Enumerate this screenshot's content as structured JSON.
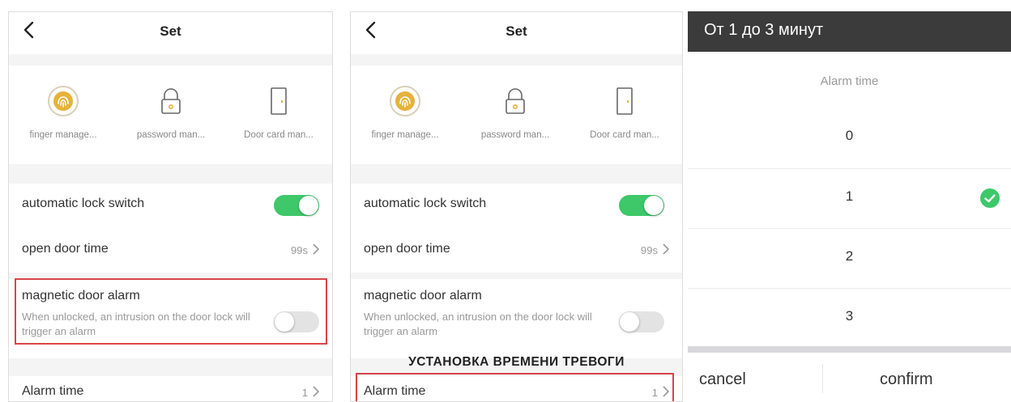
{
  "colors": {
    "accent_green": "#3ec86a",
    "highlight_red": "#d9434a",
    "header_dark": "#3b3b3b"
  },
  "left_screen": {
    "title": "Set",
    "quick_actions": [
      {
        "label": "finger manage...",
        "icon": "fingerprint-icon"
      },
      {
        "label": "password man...",
        "icon": "lock-icon"
      },
      {
        "label": "Door card man...",
        "icon": "door-icon"
      }
    ],
    "auto_lock": {
      "label": "automatic lock switch",
      "state": "on"
    },
    "open_door_time": {
      "label": "open door time",
      "value": "99s"
    },
    "magnetic_alarm": {
      "title": "magnetic door alarm",
      "description": "When unlocked, an intrusion on the door lock will trigger an alarm",
      "state": "off"
    },
    "alarm_time": {
      "label": "Alarm time",
      "value": "1"
    }
  },
  "middle_screen": {
    "title": "Set",
    "quick_actions": [
      {
        "label": "finger manage...",
        "icon": "fingerprint-icon"
      },
      {
        "label": "password man...",
        "icon": "lock-icon"
      },
      {
        "label": "Door card man...",
        "icon": "door-icon"
      }
    ],
    "auto_lock": {
      "label": "automatic lock switch",
      "state": "on"
    },
    "open_door_time": {
      "label": "open door time",
      "value": "99s"
    },
    "magnetic_alarm": {
      "title": "magnetic door alarm",
      "description": "When unlocked, an intrusion on the door lock will trigger an alarm",
      "state": "off"
    },
    "caption": "УСТАНОВКА ВРЕМЕНИ ТРЕВОГИ",
    "alarm_time": {
      "label": "Alarm time",
      "value": "1"
    }
  },
  "picker": {
    "header": "От 1 до 3 минут",
    "subtitle": "Alarm time",
    "options": [
      "0",
      "1",
      "2",
      "3"
    ],
    "selected": "1",
    "cancel_label": "cancel",
    "confirm_label": "confirm"
  }
}
